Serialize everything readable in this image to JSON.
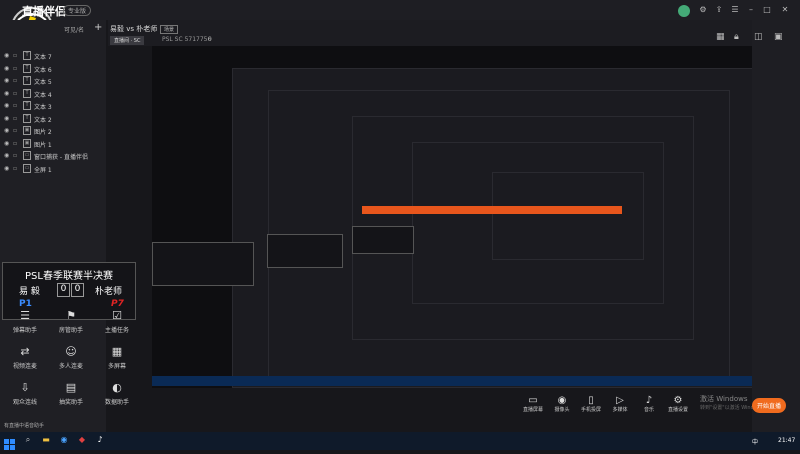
{
  "app": {
    "name": "直播伴侣",
    "version_badge": "专业版"
  },
  "layers_panel": {
    "title": "可见/名",
    "add": "+",
    "items": [
      {
        "label": "文本 7",
        "type": "T"
      },
      {
        "label": "文本 6",
        "type": "T"
      },
      {
        "label": "文本 5",
        "type": "T"
      },
      {
        "label": "文本 4",
        "type": "T"
      },
      {
        "label": "文本 3",
        "type": "T"
      },
      {
        "label": "文本 2",
        "type": "T"
      },
      {
        "label": "图片 2",
        "type": "▣"
      },
      {
        "label": "图片 1",
        "type": "▣"
      },
      {
        "label": "窗口捕获 - 直播伴侣",
        "type": "▭"
      },
      {
        "label": "全屏 1",
        "type": "▭"
      }
    ]
  },
  "scoreboard": {
    "title": "PSL春季联赛半决赛",
    "player1": "易 毅",
    "player2": "朴老师",
    "score1": "0",
    "score2": "0",
    "p1_tag": "P1",
    "p2_tag": "P7"
  },
  "functions": [
    {
      "label": "弹幕助手",
      "icon": "☰"
    },
    {
      "label": "房管助手",
      "icon": "⚑"
    },
    {
      "label": "主播任务",
      "icon": "☑"
    },
    {
      "label": "视频连麦",
      "icon": "⇄"
    },
    {
      "label": "多人连麦",
      "icon": "☺"
    },
    {
      "label": "多屏幕",
      "icon": "▦"
    },
    {
      "label": "观众连线",
      "icon": "⇩"
    },
    {
      "label": "抽奖助手",
      "icon": "▤"
    },
    {
      "label": "数据助手",
      "icon": "◐"
    }
  ],
  "header": {
    "scene_title": "易毅 vs 朴老师",
    "scene_badge": "场景",
    "room_button": "直播间 · SC",
    "psl_code": "PSL SC 5717756",
    "viewers": "0"
  },
  "bottom_toolbar": [
    {
      "label": "直播屏幕",
      "icon": "▭"
    },
    {
      "label": "摄像头",
      "icon": "◉"
    },
    {
      "label": "手机投屏",
      "icon": "▯"
    },
    {
      "label": "多媒体",
      "icon": "▷"
    },
    {
      "label": "音乐",
      "icon": "♪"
    },
    {
      "label": "直播设置",
      "icon": "⚙"
    }
  ],
  "start_live": "开始直播",
  "windows_activation": {
    "line1": "激活 Windows",
    "line2": "转到\"设置\"以激活 Windows。"
  },
  "notification": "有直播中语音助手",
  "taskbar": {
    "time": "21:47",
    "lang": "中"
  }
}
